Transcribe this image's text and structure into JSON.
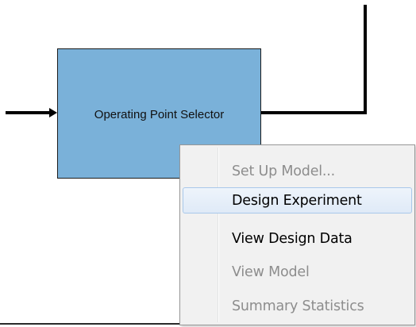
{
  "diagram": {
    "block_label": "Operating Point Selector",
    "block_color": "#7ab1d9"
  },
  "context_menu": {
    "items": [
      {
        "label": "Set Up Model...",
        "enabled": false,
        "highlighted": false
      },
      {
        "label": "Design Experiment",
        "enabled": true,
        "highlighted": true
      },
      {
        "label": "View Design Data",
        "enabled": true,
        "highlighted": false
      },
      {
        "label": "View Model",
        "enabled": false,
        "highlighted": false
      },
      {
        "label": "Summary Statistics",
        "enabled": false,
        "highlighted": false
      }
    ]
  }
}
